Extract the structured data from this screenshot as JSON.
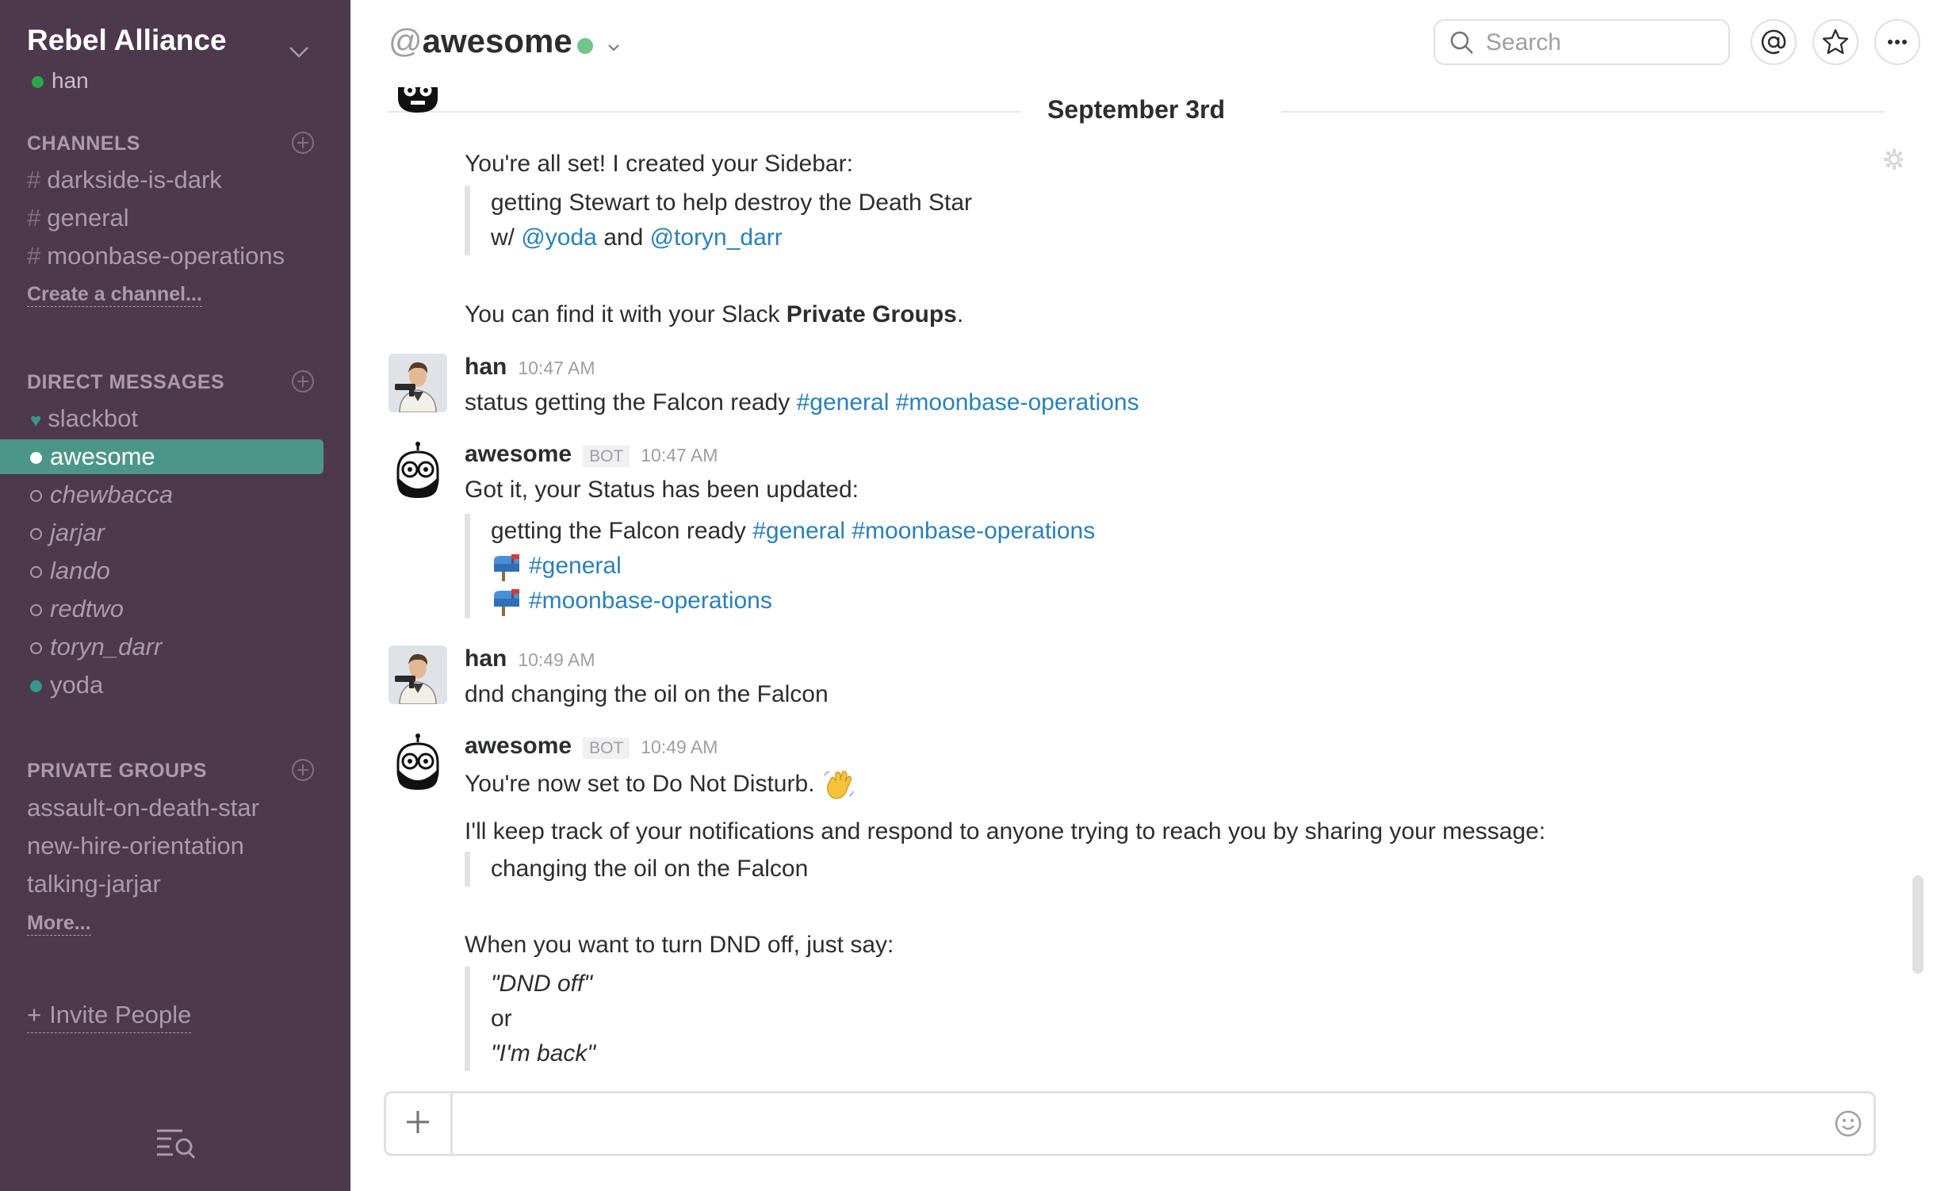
{
  "sidebar": {
    "team_name": "Rebel Alliance",
    "current_user": "han",
    "channels_heading": "CHANNELS",
    "channels": [
      {
        "hash": "#",
        "name": "darkside-is-dark"
      },
      {
        "hash": "#",
        "name": "general"
      },
      {
        "hash": "#",
        "name": "moonbase-operations"
      }
    ],
    "create_channel": "Create a channel...",
    "dm_heading": "DIRECT MESSAGES",
    "dms": [
      {
        "name": "slackbot"
      },
      {
        "name": "awesome"
      },
      {
        "name": "chewbacca"
      },
      {
        "name": "jarjar"
      },
      {
        "name": "lando"
      },
      {
        "name": "redtwo"
      },
      {
        "name": "toryn_darr"
      },
      {
        "name": "yoda"
      }
    ],
    "groups_heading": "PRIVATE GROUPS",
    "groups": [
      {
        "name": "assault-on-death-star"
      },
      {
        "name": "new-hire-orientation"
      },
      {
        "name": "talking-jarjar"
      }
    ],
    "more": "More...",
    "invite_plus": "+",
    "invite": "Invite People"
  },
  "header": {
    "at": "@",
    "channel_name": "awesome",
    "search_placeholder": "Search"
  },
  "messages": {
    "date": "September 3rd",
    "m0": {
      "text": "You're all set! I created your Sidebar:",
      "quote_line1": "getting Stewart to help destroy the Death Star",
      "quote_line2_prefix": "w/ ",
      "quote_mention1": "@yoda",
      "quote_and": " and ",
      "quote_mention2": "@toryn_darr",
      "find_text": "You can find it with your Slack ",
      "find_bold": "Private Groups",
      "find_end": "."
    },
    "m1": {
      "sender": "han",
      "time": "10:47 AM",
      "text": "status getting the Falcon ready ",
      "link1": "#general",
      "link2": "#moonbase-operations"
    },
    "m2": {
      "sender": "awesome",
      "badge": "BOT",
      "time": "10:47 AM",
      "text": "Got it, your Status has been updated:",
      "q1_text": "getting the Falcon ready ",
      "q1_link1": "#general",
      "q1_link2": "#moonbase-operations",
      "q2_link": "#general",
      "q3_link": "#moonbase-operations"
    },
    "m3": {
      "sender": "han",
      "time": "10:49 AM",
      "text": "dnd changing the oil on the Falcon"
    },
    "m4": {
      "sender": "awesome",
      "badge": "BOT",
      "time": "10:49 AM",
      "text1": "You're now set to Do Not Disturb.",
      "text2": "I'll keep track of your notifications and respond to anyone trying to reach you by sharing your message:",
      "quote1": "changing the oil on the Falcon",
      "text3": "When you want to turn DND off, just say:",
      "q_line1": "\"DND off\"",
      "q_line2": "or",
      "q_line3": "\"I'm back\""
    }
  },
  "colors": {
    "sidebar_bg": "#4d394b",
    "active_item": "#4c9689",
    "link": "#2a80b9",
    "presence_online": "#38978d"
  }
}
